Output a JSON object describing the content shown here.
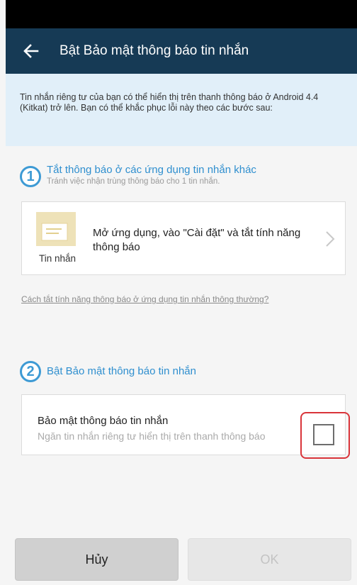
{
  "app_bar": {
    "title": "Bật Bảo mật thông báo tin nhắn",
    "back_icon": "arrow-left-icon"
  },
  "info_banner": {
    "text": "Tin nhắn riêng tư của bạn có thể hiển thị trên thanh thông báo ở Android 4.4 (Kitkat) trở lên. Bạn có thể khắc phục lỗi này theo các bước sau:"
  },
  "step1": {
    "number": "1",
    "title": "Tắt thông báo ở các ứng dụng tin nhắn khác",
    "subtitle": "Tránh việc nhận trùng thông báo cho 1 tin nhắn.",
    "card": {
      "app_label": "Tin nhắn",
      "instruction": "Mở ứng dụng, vào \"Cài đặt\" và tắt tính năng thông báo"
    },
    "help_link": "Cách tắt tính năng thông báo ở ứng dụng tin nhắn thông thường?"
  },
  "step2": {
    "number": "2",
    "title": "Bật Bảo mật thông báo tin nhắn",
    "card": {
      "title": "Bảo mật thông báo tin nhắn",
      "subtitle": "Ngăn tin nhắn riêng tư hiển thị trên thanh thông báo",
      "checked": false
    }
  },
  "buttons": {
    "cancel": "Hủy",
    "ok": "OK"
  },
  "colors": {
    "app_bar": "#163a55",
    "accent": "#3d9ad4",
    "highlight": "#d9343a",
    "banner": "#e1eff9"
  }
}
